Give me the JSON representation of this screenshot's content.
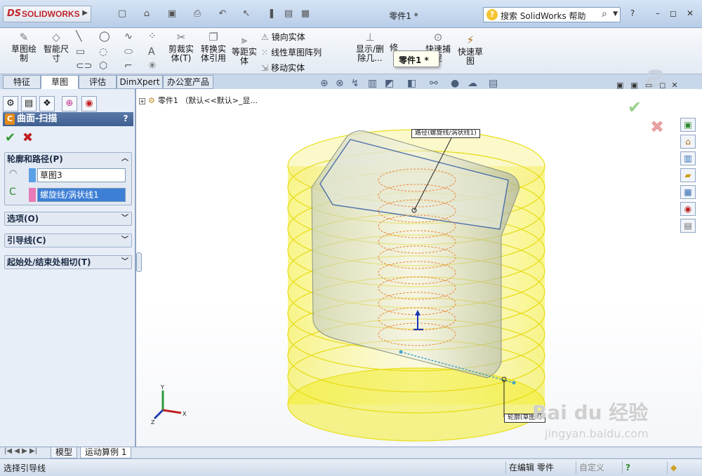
{
  "app": {
    "logo_ds": "DS",
    "logo_text": "SOLIDWORKS",
    "doc_title": "零件1 *",
    "search_placeholder": "搜索 SolidWorks 帮助"
  },
  "commands": {
    "sketch": "草图绘\n制",
    "smart_dim": "智能尺\n寸",
    "trim": "剪裁实\n体(T)",
    "convert": "转换实\n体引用",
    "offset": "等距实\n体",
    "mirror": "镜向实体",
    "linear_pattern": "线性草图阵列",
    "move": "移动实体",
    "show_delete": "显示/删\n除几...",
    "repair": "修",
    "quick_snap": "快速捕\n捉",
    "rapid_sketch": "快速草\n图"
  },
  "tooltip": "零件1 *",
  "tabs": [
    "特征",
    "草图",
    "评估",
    "DimXpert",
    "办公室产品"
  ],
  "active_tab": "草图",
  "tree_root": "零件1 （默认<<默认>_显...",
  "property_manager": {
    "title": "曲面-扫描",
    "help": "?",
    "ok": "✔",
    "cancel": "✖",
    "group_profile_path": "轮廓和路径(P)",
    "profile_value": "草图3",
    "path_value": "螺旋线/涡状线1",
    "group_options": "选项(O)",
    "group_guides": "引导线(C)",
    "group_tangency": "起始处/结束处相切(T)",
    "profile_color": "#5aa0e6",
    "path_color": "#e87bb7"
  },
  "callouts": {
    "path_label": "路径(螺旋线/涡状线1)",
    "profile_label": "轮廓(草图3)"
  },
  "triad": {
    "x": "X",
    "y": "Y",
    "z": "Z"
  },
  "bottom_tabs": [
    "模型",
    "运动算例 1"
  ],
  "status": {
    "message": "选择引导线",
    "edit_mode": "在编辑 零件",
    "custom": "自定义",
    "help_icon": "?"
  },
  "watermark": {
    "brand": "Bai du 经验",
    "url": "jingyan.baidu.com"
  },
  "colors": {
    "surface_yellow": "#f5ef3a",
    "helix_orange": "#e8893a",
    "titlebar": "#c6d6ec"
  }
}
